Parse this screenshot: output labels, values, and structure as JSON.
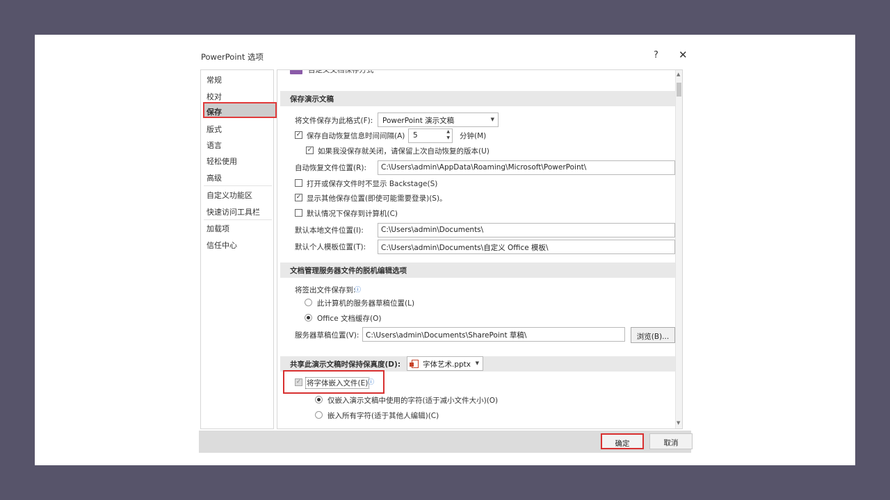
{
  "dialog": {
    "title": "PowerPoint 选项",
    "help": "?",
    "close": "✕"
  },
  "nav": {
    "items": [
      "常规",
      "校对",
      "保存",
      "版式",
      "语言",
      "轻松使用",
      "高级",
      "自定义功能区",
      "快速访问工具栏",
      "加载项",
      "信任中心"
    ],
    "selected": "保存"
  },
  "top_partial": "自定义文档保存方式",
  "save": {
    "section": "保存演示文稿",
    "format_label": "将文件保存为此格式(F):",
    "format_value": "PowerPoint 演示文稿",
    "autorecover_label": "保存自动恢复信息时间间隔(A)",
    "autorecover_checked": true,
    "autorecover_minutes": "5",
    "minutes_label": "分钟(M)",
    "keep_last_label": "如果我没保存就关闭，请保留上次自动恢复的版本(U)",
    "keep_last_checked": true,
    "autorecover_path_label": "自动恢复文件位置(R):",
    "autorecover_path": "C:\\Users\\admin\\AppData\\Roaming\\Microsoft\\PowerPoint\\",
    "no_backstage_label": "打开或保存文件时不显示 Backstage(S)",
    "no_backstage_checked": false,
    "show_other_label": "显示其他保存位置(即使可能需要登录)(S)。",
    "show_other_checked": true,
    "save_to_computer_label": "默认情况下保存到计算机(C)",
    "save_to_computer_checked": false,
    "local_path_label": "默认本地文件位置(I):",
    "local_path": "C:\\Users\\admin\\Documents\\",
    "template_path_label": "默认个人模板位置(T):",
    "template_path": "C:\\Users\\admin\\Documents\\自定义 Office 模板\\"
  },
  "offline": {
    "section": "文档管理服务器文件的脱机编辑选项",
    "save_to_label": "将签出文件保存到:",
    "radio_server": "此计算机的服务器草稿位置(L)",
    "radio_server_on": false,
    "radio_cache": "Office 文档缓存(O)",
    "radio_cache_on": true,
    "drafts_label": "服务器草稿位置(V):",
    "drafts_path": "C:\\Users\\admin\\Documents\\SharePoint 草稿\\",
    "browse": "浏览(B)..."
  },
  "fidelity": {
    "section": "共享此演示文稿时保持保真度(D):",
    "file": "字体艺术.pptx",
    "embed_label": "将字体嵌入文件(E)",
    "embed_checked": true,
    "radio_used": "仅嵌入演示文稿中使用的字符(适于减小文件大小)(O)",
    "radio_used_on": true,
    "radio_all": "嵌入所有字符(适于其他人编辑)(C)",
    "radio_all_on": false
  },
  "footer": {
    "ok": "确定",
    "cancel": "取消"
  },
  "colors": {
    "highlight": "#d83030",
    "selected_nav": "#cdcdcd",
    "section_bg": "#e8e8e8"
  }
}
